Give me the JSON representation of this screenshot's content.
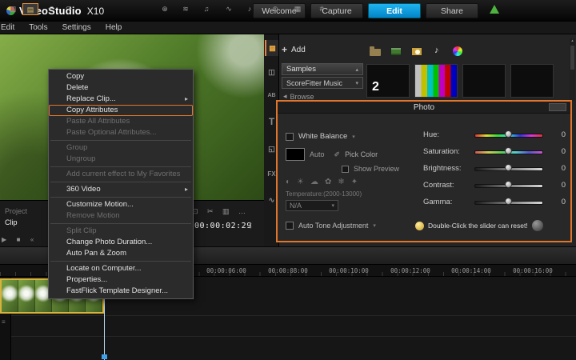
{
  "app": {
    "logo": {
      "brand": "VideoStudio",
      "version": "X10"
    },
    "tabs": [
      {
        "label": "Welcome"
      },
      {
        "label": "Capture"
      },
      {
        "label": "Edit"
      },
      {
        "label": "Share"
      }
    ]
  },
  "menubar": {
    "items": [
      {
        "label": "Edit"
      },
      {
        "label": "Tools"
      },
      {
        "label": "Settings"
      },
      {
        "label": "Help"
      }
    ]
  },
  "context_menu": {
    "items": [
      {
        "label": "Copy"
      },
      {
        "label": "Delete"
      },
      {
        "label": "Replace Clip..."
      },
      {
        "label": "Copy Attributes"
      },
      {
        "label": "Paste All Attributes"
      },
      {
        "label": "Paste Optional Attributes..."
      },
      {
        "label": "Group"
      },
      {
        "label": "Ungroup"
      },
      {
        "label": "Add current effect to My Favorites"
      },
      {
        "label": "360 Video"
      },
      {
        "label": "Customize Motion..."
      },
      {
        "label": "Remove Motion"
      },
      {
        "label": "Split Clip"
      },
      {
        "label": "Change Photo Duration..."
      },
      {
        "label": "Auto Pan & Zoom"
      },
      {
        "label": "Locate on Computer..."
      },
      {
        "label": "Properties..."
      },
      {
        "label": "FastFlick Template Designer..."
      }
    ]
  },
  "preview": {
    "project_label": "Project",
    "clip_label": "Clip",
    "timecode": "00:00:02:29"
  },
  "library": {
    "add_label": "Add",
    "samples_label": "Samples",
    "music_category": "ScoreFitter Music",
    "browse_label": "Browse",
    "thumb_number": "2"
  },
  "photo_panel": {
    "title": "Photo",
    "white_balance": "White Balance",
    "auto": "Auto",
    "pick_color": "Pick Color",
    "show_preview": "Show Preview",
    "temperature_label": "Temperature:(2000-13000)",
    "temperature_value": "N/A",
    "sliders": [
      {
        "label": "Hue:",
        "value": "0"
      },
      {
        "label": "Saturation:",
        "value": "0"
      },
      {
        "label": "Brightness:",
        "value": "0"
      },
      {
        "label": "Contrast:",
        "value": "0"
      },
      {
        "label": "Gamma:",
        "value": "0"
      }
    ],
    "auto_tone": "Auto Tone Adjustment",
    "hint": "Double-Click the slider can reset!"
  },
  "timeline": {
    "ruler_ticks": [
      "00:00:06:00",
      "00:00:08:00",
      "00:00:10:00",
      "00:00:12:00",
      "00:00:14:00",
      "00:00:16:00"
    ]
  },
  "icons": {
    "plus": "+",
    "collapse_up": "▴",
    "dropdown": "▾",
    "submenu": "▸",
    "back": "◂",
    "note": "♪",
    "notes": "♫",
    "play": "▶",
    "stop": "■",
    "rewind": "«",
    "scissors": "✂",
    "media": "▦",
    "transitions": "◫",
    "subtitle": "AB",
    "title": "T",
    "overlay": "◱",
    "fx": "FX",
    "path": "∿",
    "storyboard": "▥",
    "timeline_view": "▤",
    "undo": "↶",
    "redo": "↷",
    "capture": "⊕",
    "ripple": "≋",
    "tracking": "⊙",
    "grid": "#",
    "track_manager": "▦",
    "wave": "∿",
    "sun": "☀",
    "cloud": "☁",
    "flower": "✿",
    "snow": "❄",
    "shade": "◐",
    "flash": "✦",
    "eyedropper": "✐",
    "more": "…",
    "fullscreen": "⊡",
    "panel_strip": "▥",
    "track_rows": "≡"
  },
  "colors": {
    "accent_orange": "#e0762c",
    "active_tab_blue": "#0aa2e0",
    "selection_yellow": "#d8b23c",
    "upgrade_green": "#4db23f"
  }
}
